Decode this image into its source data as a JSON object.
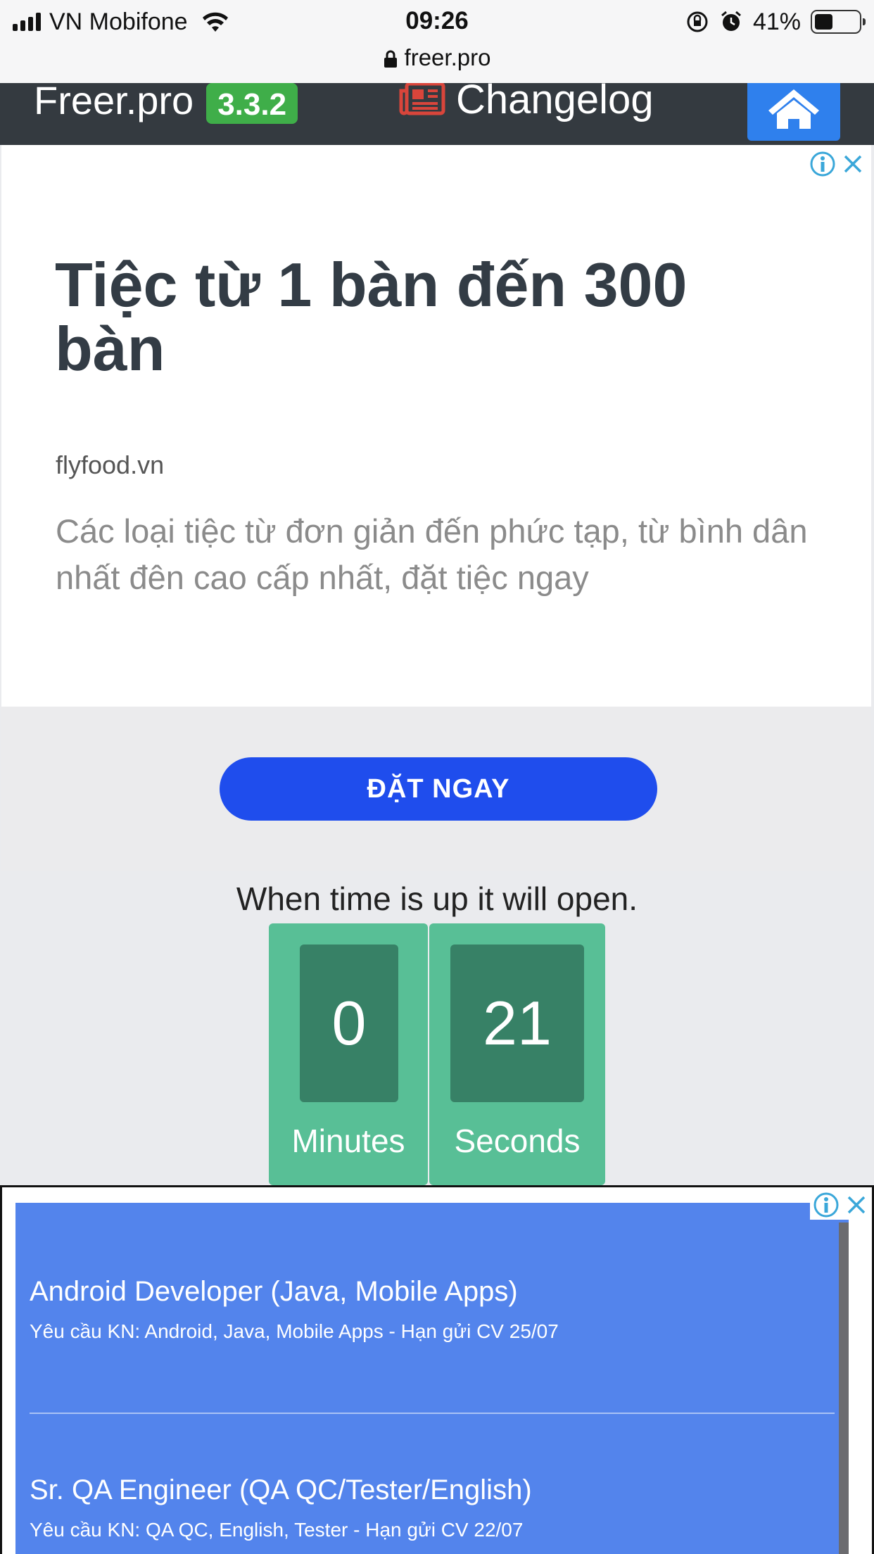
{
  "status_bar": {
    "carrier": "VN Mobifone",
    "time": "09:26",
    "battery_percent": "41%",
    "battery_level": 0.41
  },
  "browser": {
    "url": "freer.pro"
  },
  "navbar": {
    "brand": "Freer.pro",
    "version": "3.3.2",
    "changelog_label": "Changelog"
  },
  "ad1": {
    "headline": "Tiệc từ 1 bàn đến 300 bàn",
    "domain": "flyfood.vn",
    "description": "Các loại tiệc từ đơn giản đến phức tạp, từ bình dân nhất đên cao cấp nhất, đặt tiệc ngay",
    "cta": "ĐẶT NGAY"
  },
  "countdown": {
    "message": "When time is up it will open.",
    "minutes": "0",
    "minutes_label": "Minutes",
    "seconds": "21",
    "seconds_label": "Seconds"
  },
  "ad2": {
    "jobs": [
      {
        "title": "Android Developer (Java, Mobile Apps)",
        "requirements": "Yêu cầu KN: Android, Java, Mobile Apps - Hạn gửi CV 25/07"
      },
      {
        "title": "Sr. QA Engineer (QA QC/Tester/English)",
        "requirements": "Yêu cầu KN: QA QC, English, Tester - Hạn gửi CV 22/07"
      }
    ]
  },
  "colors": {
    "navbar_bg": "#343a40",
    "version_badge": "#3fae49",
    "home_button": "#2f80ed",
    "cta_button": "#1f4ded",
    "countdown_box": "#58bf96",
    "countdown_tile": "#378166",
    "ad2_bg": "#5384ec",
    "adchoices": "#3aa7d9"
  },
  "icons": {
    "wifi": "wifi-icon",
    "lock": "lock-icon",
    "rotation_lock": "rotation-lock-icon",
    "alarm": "alarm-icon",
    "changelog": "newspaper-icon",
    "home": "home-icon",
    "adchoices": "info-icon",
    "close": "close-icon"
  }
}
